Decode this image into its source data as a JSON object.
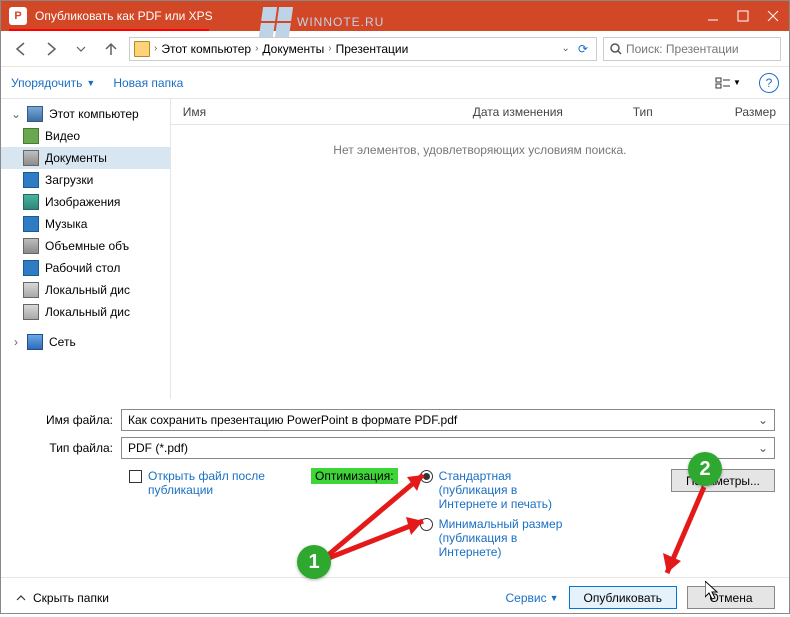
{
  "titlebar": {
    "title": "Опубликовать как PDF или XPS"
  },
  "watermark": "WINNOTE.RU",
  "breadcrumb": {
    "root": "Этот компьютер",
    "part1": "Документы",
    "part2": "Презентации"
  },
  "search": {
    "placeholder": "Поиск: Презентации"
  },
  "toolbar": {
    "organize": "Упорядочить",
    "new_folder": "Новая папка"
  },
  "columns": {
    "name": "Имя",
    "date": "Дата изменения",
    "type": "Тип",
    "size": "Размер"
  },
  "empty": "Нет элементов, удовлетворяющих условиям поиска.",
  "sidebar": {
    "pc": "Этот компьютер",
    "video": "Видео",
    "documents": "Документы",
    "downloads": "Загрузки",
    "images": "Изображения",
    "music": "Музыка",
    "volumes": "Объемные объ",
    "desktop": "Рабочий стол",
    "disk1": "Локальный дис",
    "disk2": "Локальный дис",
    "network": "Сеть"
  },
  "fields": {
    "filename_label": "Имя файла:",
    "filename_value": "Как сохранить презентацию PowerPoint в формате PDF.pdf",
    "filetype_label": "Тип файла:",
    "filetype_value": "PDF (*.pdf)"
  },
  "options": {
    "open_after": "Открыть файл после публикации",
    "optimize_label": "Оптимизация:",
    "radio_standard": "Стандартная (публикация в Интернете и печать)",
    "radio_minimal": "Минимальный размер (публикация в Интернете)",
    "params_btn": "Параметры..."
  },
  "footer": {
    "hide_folders": "Скрыть папки",
    "service": "Сервис",
    "publish": "Опубликовать",
    "cancel": "Отмена"
  },
  "callouts": {
    "c1": "1",
    "c2": "2"
  }
}
